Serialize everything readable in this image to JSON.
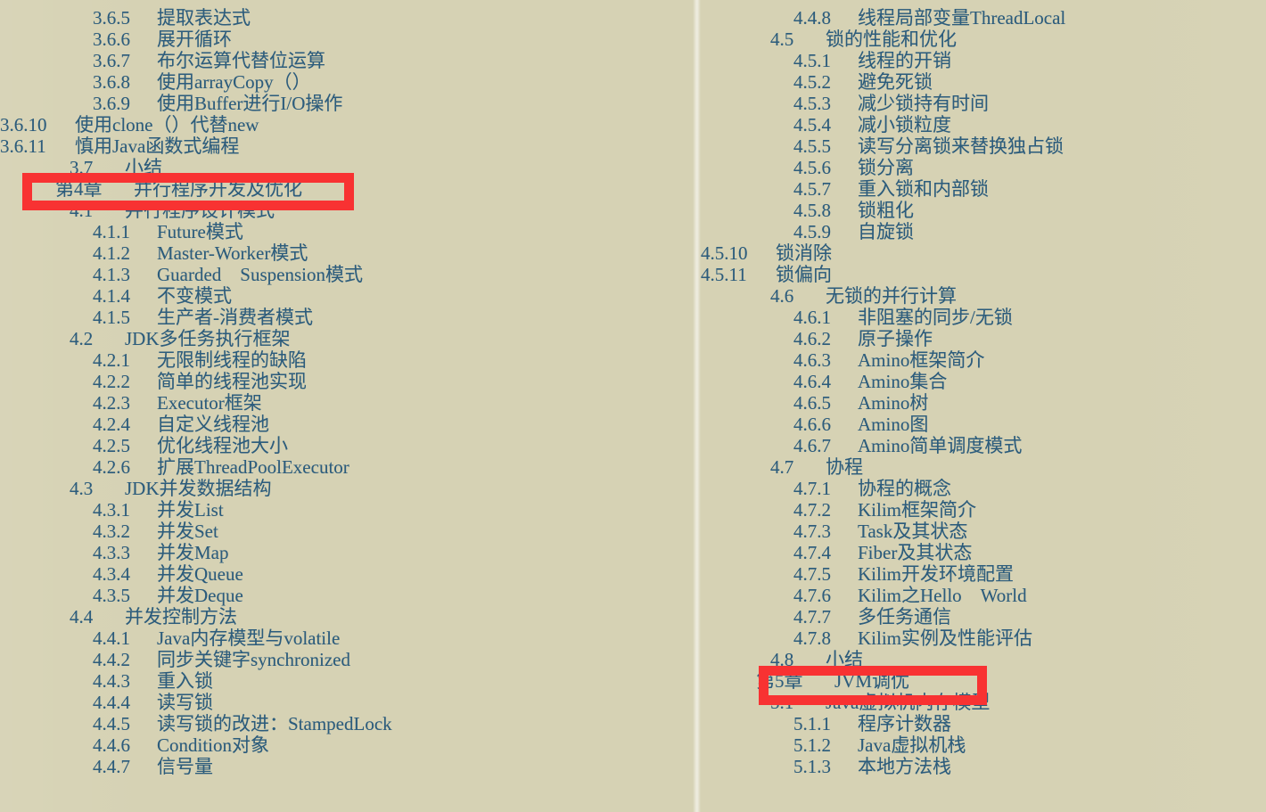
{
  "document": {
    "kind": "book-table-of-contents-scan",
    "page_background": "#d6d2b4",
    "text_color": "#2c5c7c",
    "highlight_color": "#f83232"
  },
  "highlights": [
    {
      "name": "chapter-4-highlight",
      "target": "第4章　并行程序开发及优化"
    },
    {
      "name": "chapter-5-highlight",
      "target": "第5章　JVM调优"
    }
  ],
  "left_column": {
    "rows": [
      {
        "num": "3.6.5",
        "title": "提取表达式",
        "level": "sub"
      },
      {
        "num": "3.6.6",
        "title": "展开循环",
        "level": "sub"
      },
      {
        "num": "3.6.7",
        "title": "布尔运算代替位运算",
        "level": "sub"
      },
      {
        "num": "3.6.8",
        "title": "使用arrayCopy（）",
        "level": "sub"
      },
      {
        "num": "3.6.9",
        "title": "使用Buffer进行I/O操作",
        "level": "sub"
      },
      {
        "num": "3.6.10",
        "title": "使用clone（）代替new",
        "level": "sub-wide"
      },
      {
        "num": "3.6.11",
        "title": "慎用Java函数式编程",
        "level": "sub-wide"
      },
      {
        "num": "3.7",
        "title": "小结",
        "level": "section"
      },
      {
        "num": "第4章",
        "title": "并行程序开发及优化",
        "level": "chapter"
      },
      {
        "num": "4.1",
        "title": "并行程序设计模式",
        "level": "section"
      },
      {
        "num": "4.1.1",
        "title": "Future模式",
        "level": "sub"
      },
      {
        "num": "4.1.2",
        "title": "Master-Worker模式",
        "level": "sub"
      },
      {
        "num": "4.1.3",
        "title": "Guarded　Suspension模式",
        "level": "sub"
      },
      {
        "num": "4.1.4",
        "title": "不变模式",
        "level": "sub"
      },
      {
        "num": "4.1.5",
        "title": "生产者-消费者模式",
        "level": "sub"
      },
      {
        "num": "4.2",
        "title": "JDK多任务执行框架",
        "level": "section"
      },
      {
        "num": "4.2.1",
        "title": "无限制线程的缺陷",
        "level": "sub"
      },
      {
        "num": "4.2.2",
        "title": "简单的线程池实现",
        "level": "sub"
      },
      {
        "num": "4.2.3",
        "title": "Executor框架",
        "level": "sub"
      },
      {
        "num": "4.2.4",
        "title": "自定义线程池",
        "level": "sub"
      },
      {
        "num": "4.2.5",
        "title": "优化线程池大小",
        "level": "sub"
      },
      {
        "num": "4.2.6",
        "title": "扩展ThreadPoolExecutor",
        "level": "sub"
      },
      {
        "num": "4.3",
        "title": "JDK并发数据结构",
        "level": "section"
      },
      {
        "num": "4.3.1",
        "title": "并发List",
        "level": "sub"
      },
      {
        "num": "4.3.2",
        "title": "并发Set",
        "level": "sub"
      },
      {
        "num": "4.3.3",
        "title": "并发Map",
        "level": "sub"
      },
      {
        "num": "4.3.4",
        "title": "并发Queue",
        "level": "sub"
      },
      {
        "num": "4.3.5",
        "title": "并发Deque",
        "level": "sub"
      },
      {
        "num": "4.4",
        "title": "并发控制方法",
        "level": "section"
      },
      {
        "num": "4.4.1",
        "title": "Java内存模型与volatile",
        "level": "sub"
      },
      {
        "num": "4.4.2",
        "title": "同步关键字synchronized",
        "level": "sub"
      },
      {
        "num": "4.4.3",
        "title": "重入锁",
        "level": "sub"
      },
      {
        "num": "4.4.4",
        "title": "读写锁",
        "level": "sub"
      },
      {
        "num": "4.4.5",
        "title": "读写锁的改进：StampedLock",
        "level": "sub"
      },
      {
        "num": "4.4.6",
        "title": "Condition对象",
        "level": "sub"
      },
      {
        "num": "4.4.7",
        "title": "信号量",
        "level": "sub"
      }
    ]
  },
  "right_column": {
    "rows": [
      {
        "num": "4.4.8",
        "title": "线程局部变量ThreadLocal",
        "level": "sub"
      },
      {
        "num": "4.5",
        "title": "锁的性能和优化",
        "level": "section"
      },
      {
        "num": "4.5.1",
        "title": "线程的开销",
        "level": "sub"
      },
      {
        "num": "4.5.2",
        "title": "避免死锁",
        "level": "sub"
      },
      {
        "num": "4.5.3",
        "title": "减少锁持有时间",
        "level": "sub"
      },
      {
        "num": "4.5.4",
        "title": "减小锁粒度",
        "level": "sub"
      },
      {
        "num": "4.5.5",
        "title": "读写分离锁来替换独占锁",
        "level": "sub"
      },
      {
        "num": "4.5.6",
        "title": "锁分离",
        "level": "sub"
      },
      {
        "num": "4.5.7",
        "title": "重入锁和内部锁",
        "level": "sub"
      },
      {
        "num": "4.5.8",
        "title": "锁粗化",
        "level": "sub"
      },
      {
        "num": "4.5.9",
        "title": "自旋锁",
        "level": "sub"
      },
      {
        "num": "4.5.10",
        "title": "锁消除",
        "level": "sub-wide"
      },
      {
        "num": "4.5.11",
        "title": "锁偏向",
        "level": "sub-wide"
      },
      {
        "num": "4.6",
        "title": "无锁的并行计算",
        "level": "section"
      },
      {
        "num": "4.6.1",
        "title": "非阻塞的同步/无锁",
        "level": "sub"
      },
      {
        "num": "4.6.2",
        "title": "原子操作",
        "level": "sub"
      },
      {
        "num": "4.6.3",
        "title": "Amino框架简介",
        "level": "sub"
      },
      {
        "num": "4.6.4",
        "title": "Amino集合",
        "level": "sub"
      },
      {
        "num": "4.6.5",
        "title": "Amino树",
        "level": "sub"
      },
      {
        "num": "4.6.6",
        "title": "Amino图",
        "level": "sub"
      },
      {
        "num": "4.6.7",
        "title": "Amino简单调度模式",
        "level": "sub"
      },
      {
        "num": "4.7",
        "title": "协程",
        "level": "section"
      },
      {
        "num": "4.7.1",
        "title": "协程的概念",
        "level": "sub"
      },
      {
        "num": "4.7.2",
        "title": "Kilim框架简介",
        "level": "sub"
      },
      {
        "num": "4.7.3",
        "title": "Task及其状态",
        "level": "sub"
      },
      {
        "num": "4.7.4",
        "title": "Fiber及其状态",
        "level": "sub"
      },
      {
        "num": "4.7.5",
        "title": "Kilim开发环境配置",
        "level": "sub"
      },
      {
        "num": "4.7.6",
        "title": "Kilim之Hello　World",
        "level": "sub"
      },
      {
        "num": "4.7.7",
        "title": "多任务通信",
        "level": "sub"
      },
      {
        "num": "4.7.8",
        "title": "Kilim实例及性能评估",
        "level": "sub"
      },
      {
        "num": "4.8",
        "title": "小结",
        "level": "section"
      },
      {
        "num": "第5章",
        "title": "JVM调优",
        "level": "chapter"
      },
      {
        "num": "5.1",
        "title": "Java虚拟机内存模型",
        "level": "section"
      },
      {
        "num": "5.1.1",
        "title": "程序计数器",
        "level": "sub"
      },
      {
        "num": "5.1.2",
        "title": "Java虚拟机栈",
        "level": "sub"
      },
      {
        "num": "5.1.3",
        "title": "本地方法栈",
        "level": "sub"
      }
    ]
  }
}
